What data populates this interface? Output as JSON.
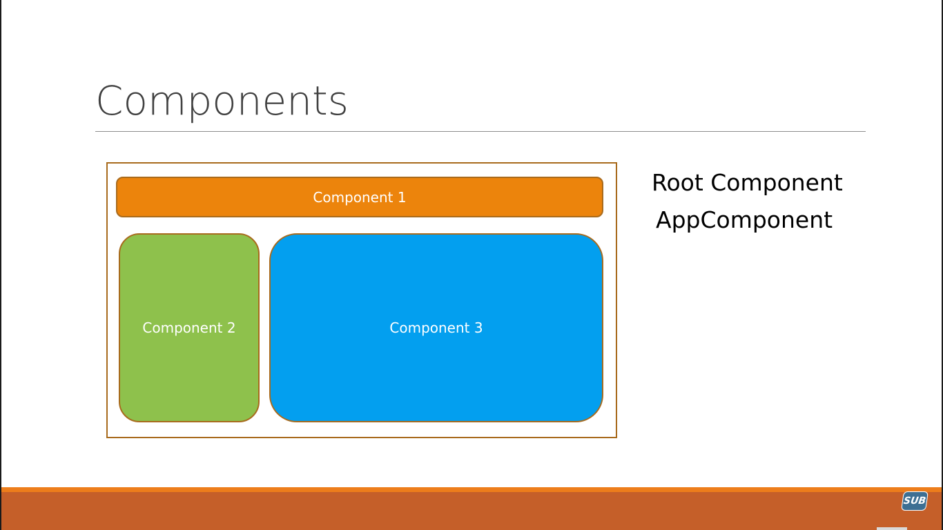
{
  "slide": {
    "title": "Components",
    "diagram": {
      "component_1": "Component 1",
      "component_2": "Component 2",
      "component_3": "Component 3"
    },
    "side_text": {
      "line1": "Root Component",
      "line2": "AppComponent"
    },
    "badge": "SUB",
    "colors": {
      "component_1": "#ec840c",
      "component_2": "#8ec14c",
      "component_3": "#039fef",
      "frame_border": "#a86a1c",
      "footer": "#c55f29",
      "footer_accent": "#ed7d1b"
    }
  }
}
